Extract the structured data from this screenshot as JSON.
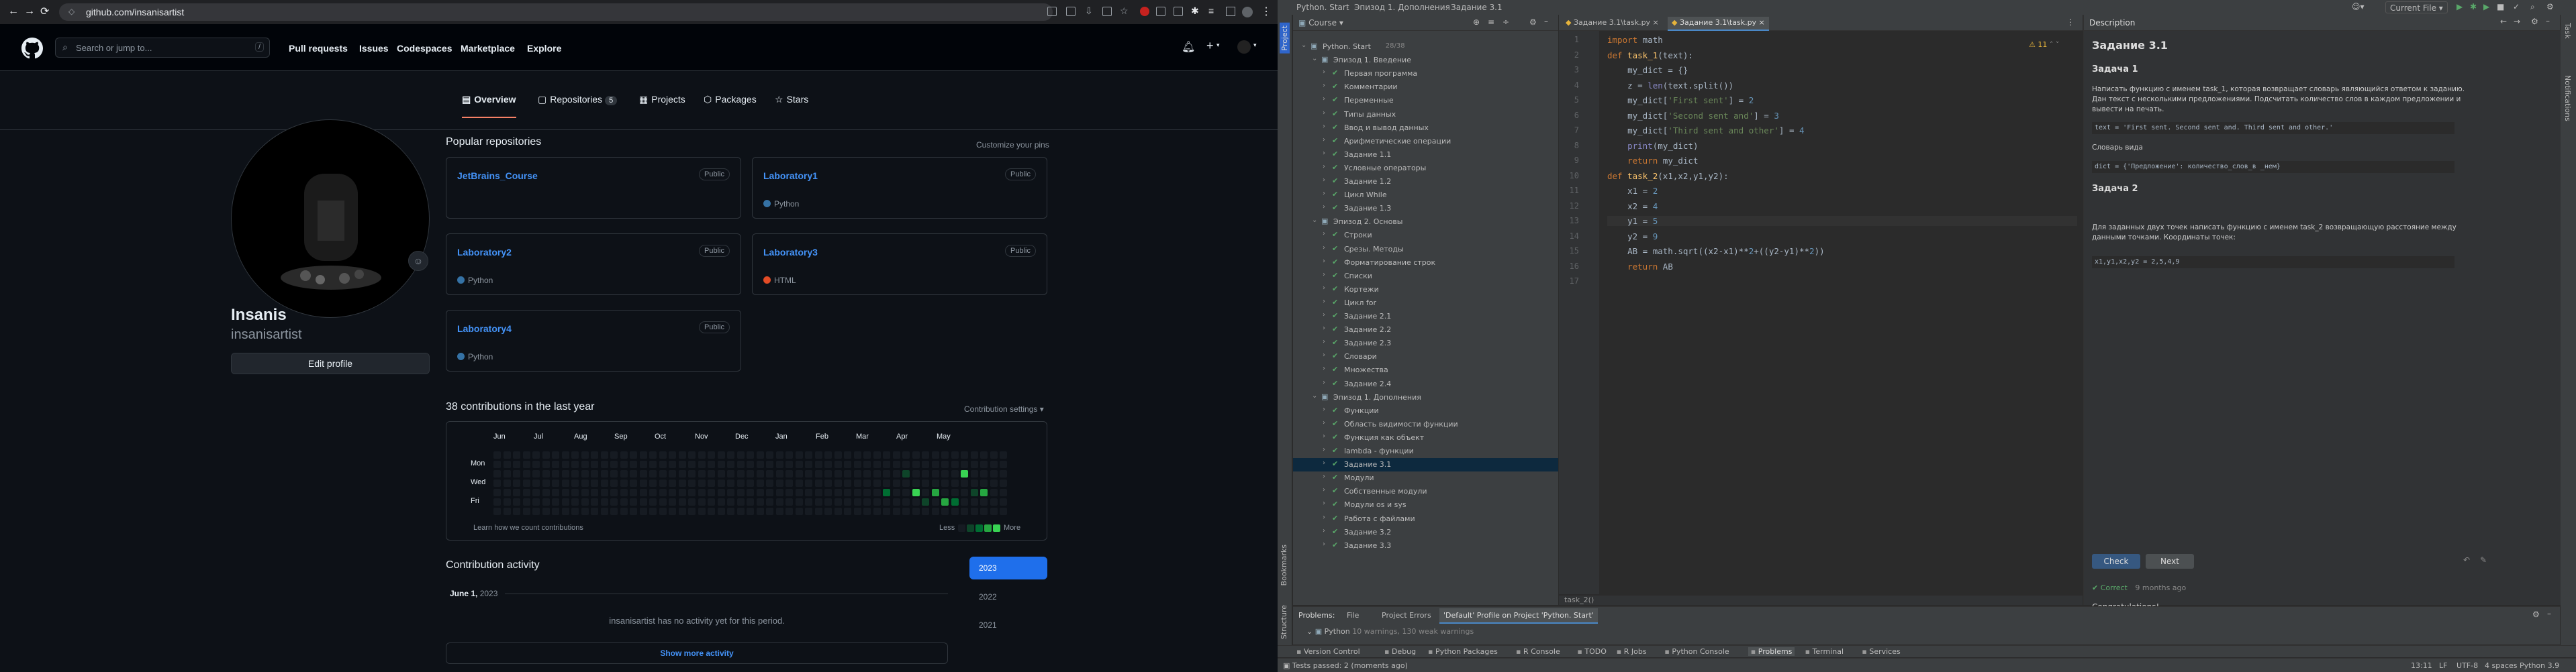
{
  "browser": {
    "url": "github.com/insanisartist",
    "back_icon": "arrow-left-icon",
    "colors": {
      "bg": "#0d1117",
      "link": "#4493f8",
      "accent": "#1f6feb",
      "green": "#39d353"
    }
  },
  "github": {
    "search_placeholder": "Search or jump to...",
    "search_shortcut": "/",
    "nav": [
      "Pull requests",
      "Issues",
      "Codespaces",
      "Marketplace",
      "Explore"
    ],
    "tabs": [
      {
        "label": "Overview"
      },
      {
        "label": "Repositories",
        "count": "5"
      },
      {
        "label": "Projects"
      },
      {
        "label": "Packages"
      },
      {
        "label": "Stars"
      }
    ],
    "profile": {
      "name": "Insanis",
      "login": "insanisartist",
      "edit_label": "Edit profile"
    },
    "popular": {
      "title": "Popular repositories",
      "customize": "Customize your pins",
      "repos": [
        {
          "name": "JetBrains_Course",
          "visibility": "Public",
          "lang": ""
        },
        {
          "name": "Laboratory1",
          "visibility": "Public",
          "lang": "Python"
        },
        {
          "name": "Laboratory2",
          "visibility": "Public",
          "lang": "Python"
        },
        {
          "name": "Laboratory3",
          "visibility": "Public",
          "lang": "HTML"
        },
        {
          "name": "Laboratory4",
          "visibility": "Public",
          "lang": "Python"
        }
      ]
    },
    "contrib": {
      "title": "38 contributions in the last year",
      "settings": "Contribution settings",
      "months": [
        "Jun",
        "Jul",
        "Aug",
        "Sep",
        "Oct",
        "Nov",
        "Dec",
        "Jan",
        "Feb",
        "Mar",
        "Apr",
        "May"
      ],
      "days": [
        "Mon",
        "Wed",
        "Fri"
      ],
      "learn": "Learn how we count contributions",
      "less": "Less",
      "more": "More"
    },
    "activity": {
      "title": "Contribution activity",
      "date_bold": "June 1,",
      "date_year": "2023",
      "empty": "insanisartist has no activity yet for this period.",
      "show_more": "Show more activity",
      "years": [
        "2023",
        "2022",
        "2021"
      ]
    }
  },
  "ide": {
    "title_items": [
      "Python. Start",
      "Эпизод 1. Дополнения",
      "Задание 3.1"
    ],
    "config_label": "Current File",
    "project_panel_label": "Course",
    "tree": [
      {
        "label": "Python. Start",
        "extra": "28/38",
        "level": 0
      },
      {
        "label": "Эпизод 1. Введение",
        "level": 1
      },
      {
        "label": "Первая программа",
        "level": 2
      },
      {
        "label": "Комментарии",
        "level": 2
      },
      {
        "label": "Переменные",
        "level": 2
      },
      {
        "label": "Типы данных",
        "level": 2
      },
      {
        "label": "Ввод и вывод данных",
        "level": 2
      },
      {
        "label": "Арифметические операции",
        "level": 2
      },
      {
        "label": "Задание 1.1",
        "level": 2
      },
      {
        "label": "Условные операторы",
        "level": 2
      },
      {
        "label": "Задание 1.2",
        "level": 2
      },
      {
        "label": "Цикл While",
        "level": 2
      },
      {
        "label": "Задание 1.3",
        "level": 2
      },
      {
        "label": "Эпизод 2. Основы",
        "level": 1
      },
      {
        "label": "Строки",
        "level": 2
      },
      {
        "label": "Срезы. Методы",
        "level": 2
      },
      {
        "label": "Форматирование строк",
        "level": 2
      },
      {
        "label": "Списки",
        "level": 2
      },
      {
        "label": "Кортежи",
        "level": 2
      },
      {
        "label": "Цикл for",
        "level": 2
      },
      {
        "label": "Задание 2.1",
        "level": 2
      },
      {
        "label": "Задание 2.2",
        "level": 2
      },
      {
        "label": "Задание 2.3",
        "level": 2
      },
      {
        "label": "Словари",
        "level": 2
      },
      {
        "label": "Множества",
        "level": 2
      },
      {
        "label": "Задание 2.4",
        "level": 2
      },
      {
        "label": "Эпизод 1. Дополнения",
        "level": 1
      },
      {
        "label": "Функции",
        "level": 2
      },
      {
        "label": "Область видимости функции",
        "level": 2
      },
      {
        "label": "Функция как объект",
        "level": 2
      },
      {
        "label": "lambda - функции",
        "level": 2
      },
      {
        "label": "Задание 3.1",
        "level": 2,
        "selected": true
      },
      {
        "label": "Модули",
        "level": 2
      },
      {
        "label": "Собственные модули",
        "level": 2
      },
      {
        "label": "Модули os и sys",
        "level": 2
      },
      {
        "label": "Работа с файлами",
        "level": 2
      },
      {
        "label": "Задание 3.2",
        "level": 2
      },
      {
        "label": "Задание 3.3",
        "level": 2
      }
    ],
    "editor_tabs": [
      "Задание 3.1\\task.py",
      "Задание 3.1\\task.py"
    ],
    "warnings": "11",
    "code": [
      "import math",
      "def task_1(text):",
      "    my_dict = {}",
      "    z = len(text.split())",
      "    my_dict['First sent'] = 2",
      "    my_dict['Second sent and'] = 3",
      "    my_dict['Third sent and other'] = 4",
      "    print(my_dict)",
      "    return my_dict",
      "def task_2(x1,x2,y1,y2):",
      "    x1 = 2",
      "    x2 = 4",
      "    y1 = 5",
      "    y2 = 9",
      "    AB = math.sqrt((x2-x1)**2+((y2-y1)**2))",
      "    return AB",
      ""
    ],
    "breadcrumb": "task_2()",
    "description": {
      "header": "Description",
      "title": "Задание 3.1",
      "task1_title": "Задача 1",
      "task1_text": "Написать функцию с именем task_1, которая возвращает словарь являющийся ответом к заданию. Дан текст с несколькими предложениями. Подсчитать количество слов в каждом предложении и вывести на печать.",
      "task1_code": "text = 'First sent. Second sent and. Third sent and other.'",
      "dict_label": "Словарь вида",
      "dict_code": "dict = {'Предложение': количество_слов_в _нем}",
      "task2_title": "Задача 2",
      "task2_text": "Для заданных двух точек написать функцию с именем task_2 возвращающую расстояние между данными точками. Координаты точек:",
      "task2_code": "x1,y1,x2,y2 = 2,5,4,9",
      "check": "Check",
      "next": "Next",
      "correct": "Correct",
      "ago": "9 months ago",
      "congrats": "Congratulations!"
    },
    "problems": {
      "tabs": [
        "Problems:",
        "File",
        "Project Errors",
        "'Default' Profile on Project 'Python. Start'"
      ],
      "python": "Python",
      "python_warn": "10 warnings, 130 weak warnings"
    },
    "bottom_tools": [
      "Version Control",
      "Debug",
      "Python Packages",
      "R Console",
      "TODO",
      "R Jobs",
      "Python Console",
      "Problems",
      "Terminal",
      "Services"
    ],
    "status": {
      "left": "Tests passed: 2 (moments ago)",
      "right": [
        "13:11",
        "LF",
        "UTF-8",
        "4 spaces",
        "Python 3.9"
      ]
    },
    "side_labels": [
      "Project",
      "Bookmarks",
      "Structure"
    ],
    "right_labels": [
      "Task",
      "Notifications"
    ]
  }
}
